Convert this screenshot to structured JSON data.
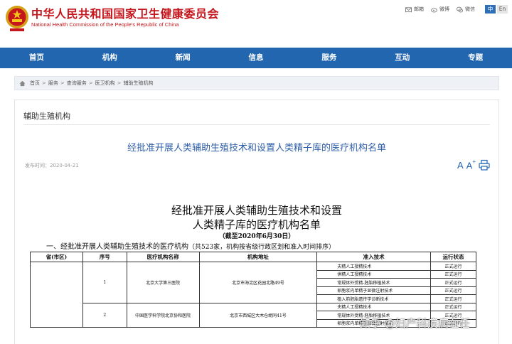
{
  "header": {
    "title": "中华人民共和国国家卫生健康委员会",
    "subtitle": "National Health Commission of the People's Republic of China",
    "links": [
      {
        "icon": "mail-icon",
        "label": "邮箱"
      },
      {
        "icon": "weibo-icon",
        "label": "微博"
      },
      {
        "icon": "wechat-icon",
        "label": "微信"
      }
    ],
    "lang_zh": "中",
    "lang_en": "En"
  },
  "nav": [
    "首页",
    "机构",
    "新闻",
    "信息",
    "服务",
    "互动",
    "专题"
  ],
  "breadcrumb": [
    "首页",
    "服务",
    "查询服务",
    "医卫机构",
    "辅助生殖机构"
  ],
  "breadcrumb_sep": ">",
  "section": "辅助生殖机构",
  "article": {
    "title": "经批准开展人类辅助生殖技术和设置人类精子库的医疗机构名单",
    "date": "发布时间：2020-04-21",
    "font_small": "A",
    "font_large": "A",
    "font_large_sup": "+"
  },
  "document": {
    "heading_line1": "经批准开展人类辅助生殖技术和设置",
    "heading_line2": "人类精子库的医疗机构名单",
    "as_of": "（截至2020年6月30日）",
    "section_title": "一、经批准开展人类辅助生殖技术的医疗机构",
    "section_note": "（共523家，机构按省级行政区划和准入时间排序）",
    "table": {
      "headers": [
        "省(市区)",
        "序号",
        "医疗机构名称",
        "机构地址",
        "准入技术",
        "运行状态"
      ],
      "institutions": [
        {
          "no": "1",
          "name": "北京大学第三医院",
          "address": "北京市海淀区花园北路49号",
          "techs": [
            {
              "tech": "夫精人工授精技术",
              "status": "正式运行"
            },
            {
              "tech": "供精人工授精技术",
              "status": "正式运行"
            },
            {
              "tech": "常规体外受精-胚胎移植技术",
              "status": "正式运行"
            },
            {
              "tech": "卵胞浆内单精子显微注射技术",
              "status": "正式运行"
            },
            {
              "tech": "植入前胚胎遗传学诊断技术",
              "status": "正式运行"
            }
          ]
        },
        {
          "no": "2",
          "name": "中国医学科学院北京协和医院",
          "address": "北京市西城区大木仓胡同41号",
          "techs": [
            {
              "tech": "夫精人工授精技术",
              "status": "正式运行"
            },
            {
              "tech": "常规体外受精-胚胎移植技术",
              "status": "正式运行"
            },
            {
              "tech": "卵胞浆内单精子显微注射技术",
              "status": "正式运行"
            }
          ]
        }
      ]
    }
  },
  "watermark": "知乎 @妇产科疾病在任"
}
